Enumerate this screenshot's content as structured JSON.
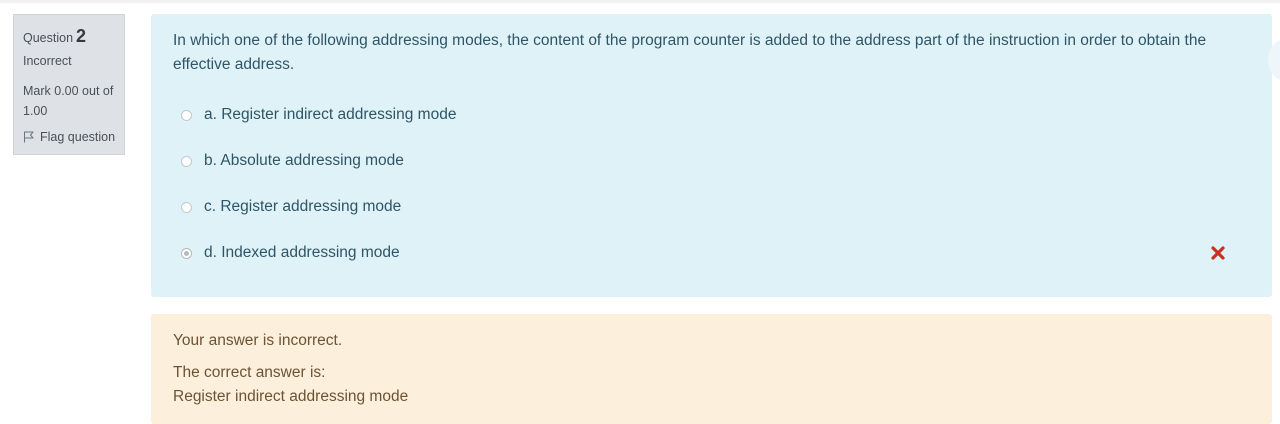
{
  "question_info": {
    "label": "Question",
    "number": "2",
    "state": "Incorrect",
    "grade": "Mark 0.00 out of 1.00",
    "flag_label": "Flag question"
  },
  "question": {
    "text": "In which one of the following addressing modes, the content of the program counter is added to the address part of the instruction in order to obtain the effective address.",
    "options": [
      {
        "label": "a. Register indirect addressing mode",
        "selected": false
      },
      {
        "label": "b. Absolute addressing mode",
        "selected": false
      },
      {
        "label": "c. Register addressing mode",
        "selected": false
      },
      {
        "label": "d. Indexed addressing mode",
        "selected": true,
        "mark": "incorrect"
      }
    ]
  },
  "feedback": {
    "status": "Your answer is incorrect.",
    "correct_intro": "The correct answer is:",
    "correct_answer": "Register indirect addressing mode"
  },
  "colors": {
    "info_bg": "#dee2e6",
    "formulation_bg": "#def2f8",
    "feedback_bg": "#fcefdc",
    "incorrect_mark": "#ca3120"
  },
  "icons": {
    "flag": "flag-icon",
    "incorrect": "cross-icon"
  }
}
